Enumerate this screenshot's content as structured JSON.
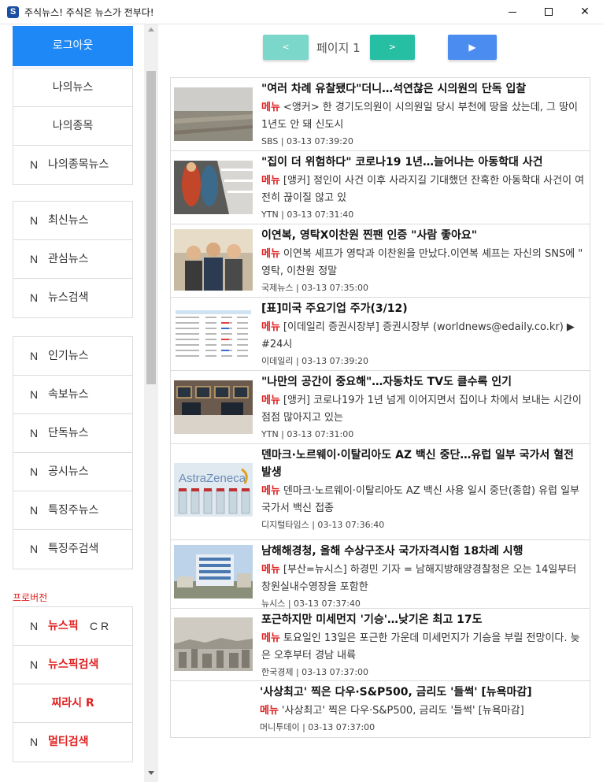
{
  "window": {
    "title": "주식뉴스! 주식은 뉴스가 전부다!",
    "icon_letter": "S",
    "controls": {
      "minimize": "",
      "maximize": "",
      "close": "✕"
    }
  },
  "sidebar": {
    "logout": "로그아웃",
    "group1": [
      {
        "n": "",
        "label": "나의뉴스"
      },
      {
        "n": "",
        "label": "나의종목"
      },
      {
        "n": "N",
        "label": "나의종목뉴스"
      }
    ],
    "group2": [
      {
        "n": "N",
        "label": "최신뉴스"
      },
      {
        "n": "N",
        "label": "관심뉴스"
      },
      {
        "n": "N",
        "label": "뉴스검색"
      }
    ],
    "group3": [
      {
        "n": "N",
        "label": "인기뉴스"
      },
      {
        "n": "N",
        "label": "속보뉴스"
      },
      {
        "n": "N",
        "label": "단독뉴스"
      },
      {
        "n": "N",
        "label": "공시뉴스"
      },
      {
        "n": "N",
        "label": "특징주뉴스"
      },
      {
        "n": "N",
        "label": "특징주검색"
      }
    ],
    "pro_label": "프로버전",
    "group4": [
      {
        "n": "N",
        "label": "뉴스픽",
        "extra": "C  R"
      },
      {
        "n": "N",
        "label": "뉴스픽검색"
      },
      {
        "n": "",
        "label": "찌라시 R"
      },
      {
        "n": "N",
        "label": "멀티검색"
      }
    ]
  },
  "pager": {
    "prev": "<",
    "label": "페이지 1",
    "next": ">",
    "play": "▶"
  },
  "news": [
    {
      "title": "\"여러 차례 유찰됐다\"더니…석연찮은 시의원의 단독 입찰",
      "menu": "메뉴",
      "summary": "<앵커> 한 경기도의원이 시의원일 당시 부천에 땅을 샀는데, 그 땅이 1년도 안 돼 신도시",
      "meta": "SBS | 03-13 07:39:20"
    },
    {
      "title": "\"집이 더 위험하다\" 코로나19 1년…늘어나는 아동학대 사건",
      "menu": "메뉴",
      "summary": "[앵커] 정인이 사건 이후 사라지길 기대했던 잔혹한 아동학대 사건이 여전히 끊이질 않고 있",
      "meta": "YTN | 03-13 07:31:40"
    },
    {
      "title": "이연복, 영탁X이찬원 찐팬 인증 \"사람 좋아요\"",
      "menu": "메뉴",
      "summary": "이연복 셰프가 영탁과 이찬원을 만났다.이연복 셰프는 자신의 SNS에 \" 영탁, 이찬원 정말",
      "meta": "국제뉴스 | 03-13 07:35:00"
    },
    {
      "title": "[표]미국 주요기업 주가(3/12)",
      "menu": "메뉴",
      "summary": "[이데일리 증권시장부] 증권시장부 (worldnews@edaily.co.kr) ▶ #24시",
      "meta": "이데일리 | 03-13 07:39:20"
    },
    {
      "title": "\"나만의 공간이 중요해\"…자동차도 TV도 클수록 인기",
      "menu": "메뉴",
      "summary": "[앵커] 코로나19가 1년 넘게 이어지면서 집이나 차에서 보내는 시간이 점점 많아지고 있는",
      "meta": "YTN | 03-13 07:31:00"
    },
    {
      "title": "덴마크·노르웨이·이탈리아도 AZ 백신 중단…유럽 일부 국가서 혈전 발생",
      "menu": "메뉴",
      "summary": "덴마크·노르웨이·이탈리아도 AZ 백신 사용 일시 중단(종합) 유럽 일부 국가서 백신 접종",
      "meta": "디지털타임스 | 03-13 07:36:40",
      "thumb_text": "AstraZeneca"
    },
    {
      "title": "남해해경청, 올해 수상구조사 국가자격시험 18차례 시행",
      "menu": "메뉴",
      "summary": "[부산=뉴시스] 하경민 기자 = 남해지방해양경찰청은 오는 14일부터 창원실내수영장을 포함한",
      "meta": "뉴시스 | 03-13 07:37:40"
    },
    {
      "title": "포근하지만 미세먼지 '기승'…낮기온 최고 17도",
      "menu": "메뉴",
      "summary": "토요일인 13일은 포근한 가운데 미세먼지가 기승을 부릴 전망이다. 늦은 오후부터 경남 내륙",
      "meta": "한국경제 | 03-13 07:37:00"
    },
    {
      "title": "'사상최고' 찍은 다우·S&P500, 금리도 '들썩' [뉴욕마감]",
      "menu": "메뉴",
      "summary": "'사상최고' 찍은 다우·S&P500, 금리도 '들썩' [뉴욕마감]",
      "meta": "머니투데이 | 03-13 07:37:00"
    }
  ]
}
